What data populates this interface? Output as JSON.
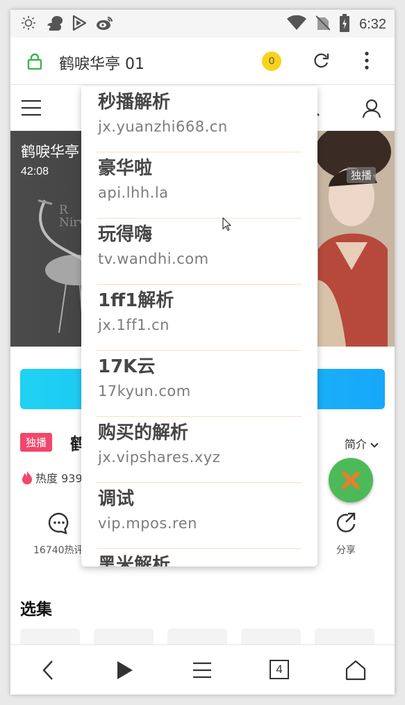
{
  "status_bar": {
    "time": "6:32"
  },
  "browser": {
    "title": "鹤唳华亭 01",
    "badge_count": "0"
  },
  "video": {
    "title": "鹤唳华亭",
    "duration": "42:08",
    "tag": "独播",
    "bg_text_1": "R",
    "bg_text_2": "Nirv"
  },
  "info": {
    "exclusive_badge": "独播",
    "title_fragment": "鹤",
    "intro_label": "简介",
    "heat_text": "热度 939",
    "comment_count": "16740热评",
    "share_label": "分享"
  },
  "episodes": {
    "title": "选集"
  },
  "dropdown": {
    "items": [
      {
        "name": "秒播解析",
        "host": "jx.yuanzhi668.cn"
      },
      {
        "name": "豪华啦",
        "host": "api.lhh.la"
      },
      {
        "name": "玩得嗨",
        "host": "tv.wandhi.com"
      },
      {
        "name": "1ff1解析",
        "host": "jx.1ff1.cn"
      },
      {
        "name": "17K云",
        "host": "17kyun.com"
      },
      {
        "name": "购买的解析",
        "host": "jx.vipshares.xyz"
      },
      {
        "name": "调试",
        "host": "vip.mpos.ren"
      },
      {
        "name": "黑米解析",
        "host": ""
      }
    ]
  },
  "bottom_nav": {
    "tabs_count": "4"
  },
  "colors": {
    "accent_blue": "#18a7fa",
    "badge_yellow": "#f8d31a",
    "exclusive_red": "#f2466a",
    "fab_green": "#4cba58",
    "fab_x": "#f07a2e",
    "lock_green": "#3ab54a"
  },
  "icons": [
    "sun-icon",
    "squirrel-icon",
    "play-store-icon",
    "weibo-icon",
    "wifi-icon",
    "no-sim-icon",
    "battery-icon",
    "lock-icon",
    "reload-icon",
    "more-icon",
    "hamburger-icon",
    "search-icon",
    "user-icon",
    "comment-icon",
    "share-icon",
    "close-icon",
    "back-icon",
    "play-icon",
    "menu-icon",
    "home-icon"
  ]
}
